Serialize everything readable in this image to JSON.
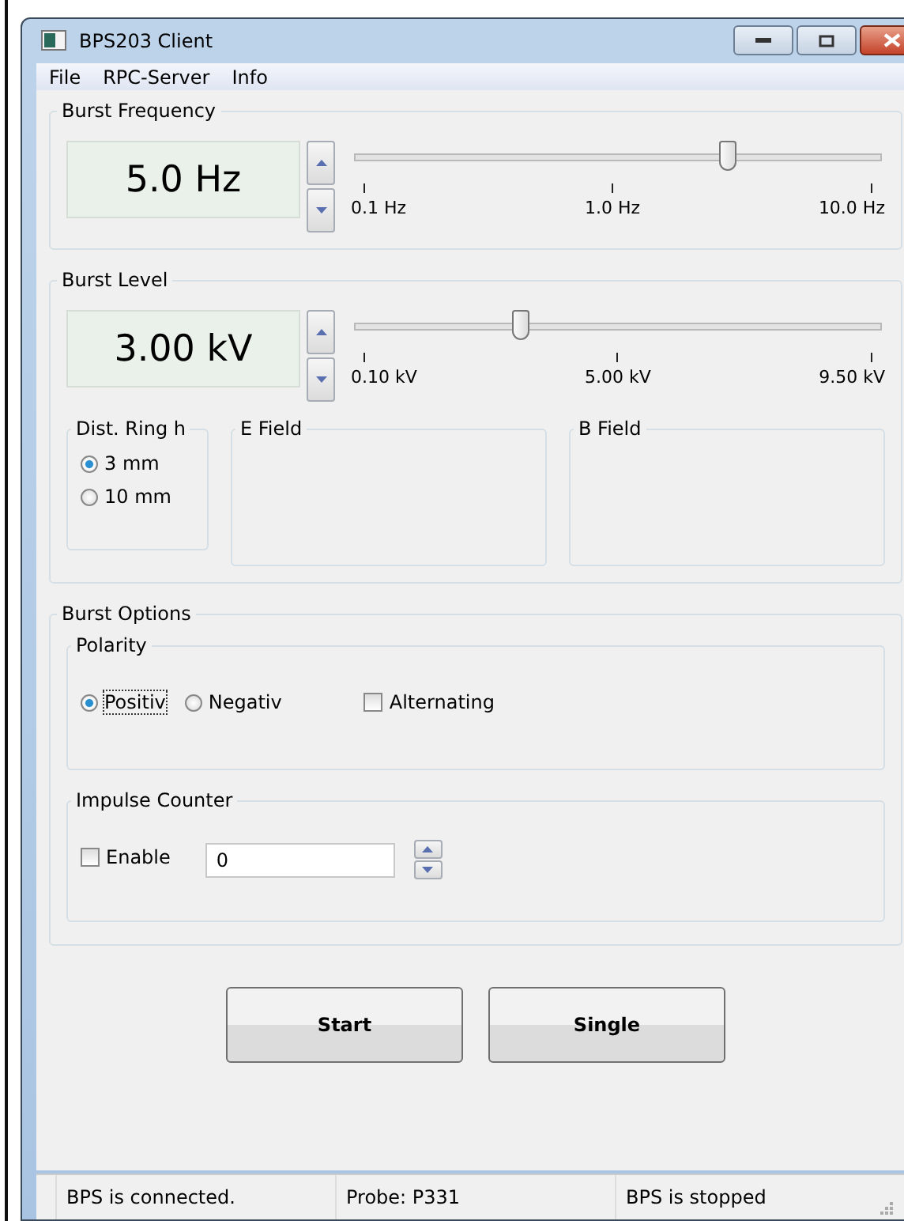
{
  "window": {
    "title": "BPS203 Client"
  },
  "menu": [
    "File",
    "RPC-Server",
    "Info"
  ],
  "frequency": {
    "title": "Burst Frequency",
    "value": "5.0 Hz",
    "level": 0.71,
    "ticks": [
      "0.1 Hz",
      "1.0 Hz",
      "10.0 Hz"
    ]
  },
  "burst_level": {
    "title": "Burst Level",
    "value": "3.00 kV",
    "level": 0.316,
    "ticks": [
      "0.10 kV",
      "5.00 kV",
      "9.50 kV"
    ],
    "dist_ring": {
      "title": "Dist. Ring h",
      "options": [
        {
          "label": "3 mm",
          "selected": true
        },
        {
          "label": "10 mm",
          "selected": false
        }
      ]
    },
    "e_field": {
      "title": "E Field"
    },
    "b_field": {
      "title": "B Field"
    }
  },
  "burst_options": {
    "title": "Burst Options",
    "polarity": {
      "title": "Polarity",
      "options": [
        {
          "label": "Positiv",
          "selected": true
        },
        {
          "label": "Negativ",
          "selected": false
        }
      ],
      "alternating": {
        "label": "Alternating",
        "checked": false
      }
    },
    "impulse_counter": {
      "title": "Impulse Counter",
      "enable": {
        "label": "Enable",
        "checked": false
      },
      "value": "0"
    }
  },
  "buttons": [
    "Start",
    "Single"
  ],
  "status_bar": [
    "BPS is connected.",
    "Probe: P331",
    "BPS is stopped"
  ]
}
